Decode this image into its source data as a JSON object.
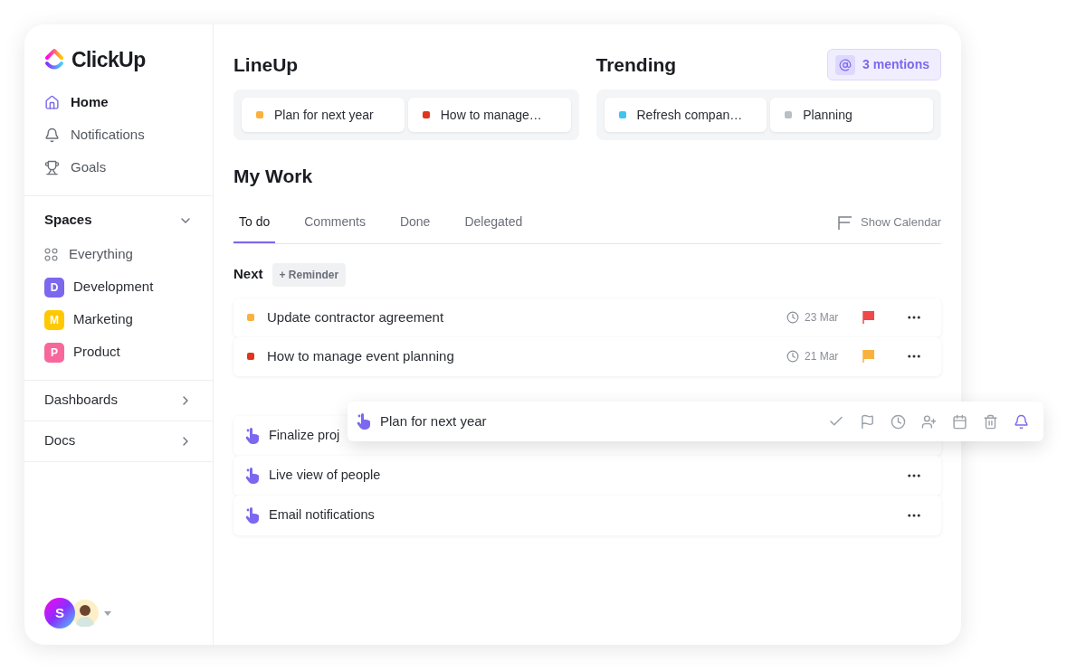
{
  "sidebar": {
    "logo": "ClickUp",
    "nav": [
      {
        "label": "Home",
        "selected": true,
        "kind": "home"
      },
      {
        "label": "Notifications",
        "selected": false,
        "kind": "bell"
      },
      {
        "label": "Goals",
        "selected": false,
        "kind": "trophy"
      }
    ],
    "spaces": {
      "title": "Spaces",
      "expanded": true,
      "items": [
        {
          "label": "Everything",
          "kind": "all"
        },
        {
          "label": "Development",
          "kind": "space",
          "initial": "D",
          "color": "#7b68ee"
        },
        {
          "label": "Marketing",
          "kind": "space",
          "initial": "M",
          "color": "#ffc800"
        },
        {
          "label": "Product",
          "kind": "space",
          "initial": "P",
          "color": "#f7679c"
        }
      ]
    },
    "sections": [
      {
        "label": "Dashboards",
        "expanded": false
      },
      {
        "label": "Docs",
        "expanded": false
      }
    ],
    "user": {
      "initial": "S"
    }
  },
  "lineup": {
    "title": "LineUp",
    "items": [
      {
        "label": "Plan for next year",
        "color": "#f9b13e"
      },
      {
        "label": "How to manage…",
        "color": "#e2341d"
      }
    ]
  },
  "trending": {
    "title": "Trending",
    "items": [
      {
        "label": "Refresh compan…",
        "color": "#40c4f0"
      },
      {
        "label": "Planning",
        "color": "#b9bec7"
      }
    ]
  },
  "mentions": "3 mentions",
  "my_work": {
    "title": "My Work",
    "tabs": [
      {
        "label": "To do",
        "selected": true
      },
      {
        "label": "Comments",
        "selected": false
      },
      {
        "label": "Done",
        "selected": false
      },
      {
        "label": "Delegated",
        "selected": false
      }
    ],
    "show_calendar": "Show Calendar",
    "group": "Next",
    "reminder_button": "+ Reminder",
    "tasks": [
      {
        "label": "Update contractor agreement",
        "color": "#f9b13e",
        "date": "23 Mar",
        "flag": {
          "color": "#f0484b"
        }
      },
      {
        "label": "How to manage event planning",
        "color": "#e2341d",
        "date": "21 Mar",
        "flag": {
          "color": "#f9b13e"
        }
      }
    ],
    "reminders": [
      {
        "label": "Finalize proj",
        "menu": false
      },
      {
        "label": "Live view of people",
        "menu": true
      },
      {
        "label": "Email notifications",
        "menu": true
      }
    ]
  },
  "floating_card": {
    "label": "Plan for next year"
  }
}
